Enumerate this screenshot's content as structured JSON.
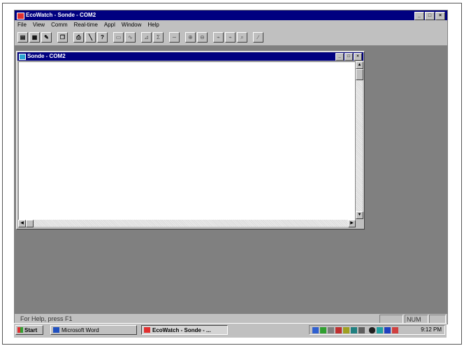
{
  "app": {
    "title": "EcoWatch - Sonde - COM2",
    "window_buttons": [
      "_",
      "□",
      "×"
    ]
  },
  "menu": [
    "File",
    "View",
    "Comm",
    "Real-time",
    "Appl",
    "Window",
    "Help"
  ],
  "toolbar": [
    {
      "icon": "open-icon",
      "glyph": "▤"
    },
    {
      "icon": "save-icon",
      "glyph": "▦"
    },
    {
      "icon": "graph-icon",
      "glyph": "✎"
    },
    {
      "icon": "copy-icon",
      "glyph": "❐"
    },
    {
      "icon": "print-icon",
      "glyph": "⎙"
    },
    {
      "icon": "pen-icon",
      "glyph": "╲"
    },
    {
      "icon": "help-icon",
      "glyph": "?"
    },
    {
      "icon": "table-icon",
      "glyph": "▭"
    },
    {
      "icon": "wave-icon",
      "glyph": "∿"
    },
    {
      "icon": "chart-icon",
      "glyph": "⊿"
    },
    {
      "icon": "stats-icon",
      "glyph": "Σ"
    },
    {
      "icon": "curve-icon",
      "glyph": "∼"
    },
    {
      "icon": "zoom-in-icon",
      "glyph": "⊕"
    },
    {
      "icon": "zoom-out-icon",
      "glyph": "⊖"
    },
    {
      "icon": "plot1-icon",
      "glyph": "⌁"
    },
    {
      "icon": "plot2-icon",
      "glyph": "⌁"
    },
    {
      "icon": "plot3-icon",
      "glyph": "⌕"
    },
    {
      "icon": "edit-icon",
      "glyph": "∕"
    }
  ],
  "child": {
    "title": "Sonde - COM2"
  },
  "status": {
    "help": "For Help, press F1",
    "num": "NUM"
  },
  "taskbar": {
    "start": "Start",
    "tasks": [
      {
        "label": "Microsoft Word",
        "active": false
      },
      {
        "label": "EcoWatch - Sonde - ...",
        "active": true
      }
    ],
    "clock": "9:12 PM"
  }
}
